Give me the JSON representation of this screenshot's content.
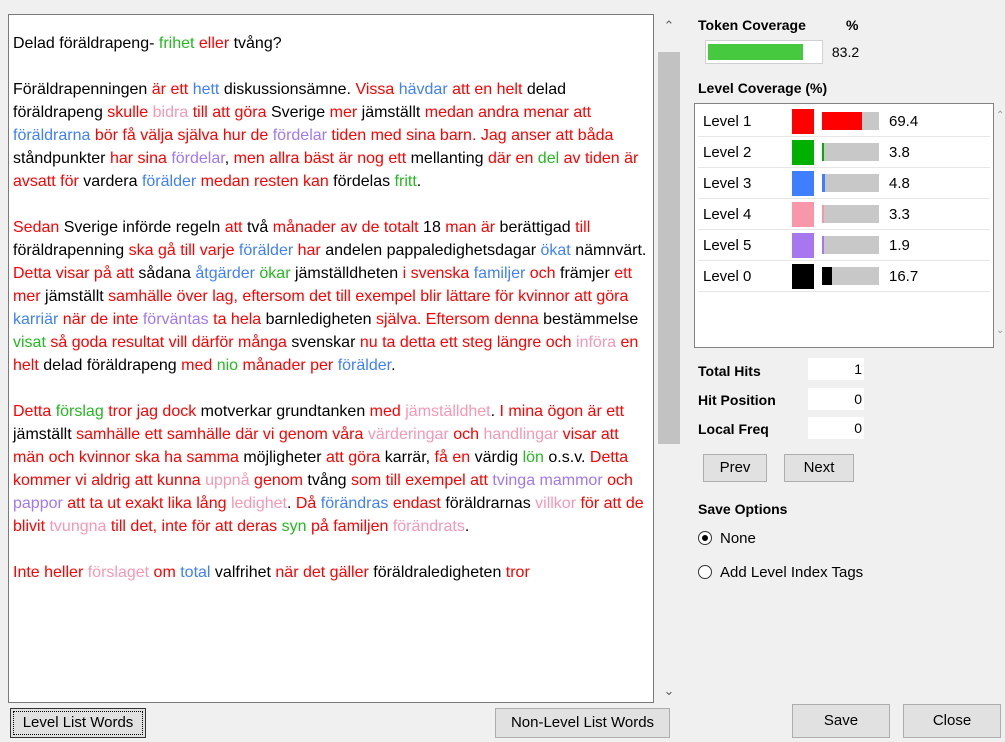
{
  "text": {
    "title": [
      [
        "lv0",
        "Delad föräldrapeng- "
      ],
      [
        "lv2",
        "frihet"
      ],
      [
        "lv0",
        " "
      ],
      [
        "lv1",
        "eller"
      ],
      [
        "lv0",
        " tvång?"
      ]
    ],
    "paragraphs": [
      [
        [
          "lv0",
          "Föräldrapenningen "
        ],
        [
          "lv1",
          "är ett"
        ],
        [
          "lv0",
          " "
        ],
        [
          "lv3",
          "hett"
        ],
        [
          "lv0",
          " diskussionsämne. "
        ],
        [
          "lv1",
          "Vissa"
        ],
        [
          "lv0",
          " "
        ],
        [
          "lv3",
          "hävdar"
        ],
        [
          "lv0",
          " "
        ],
        [
          "lv1",
          "att en helt"
        ],
        [
          "lv0",
          " delad föräldrapeng "
        ],
        [
          "lv1",
          "skulle"
        ],
        [
          "lv0",
          " "
        ],
        [
          "lv4",
          "bidra"
        ],
        [
          "lv0",
          " "
        ],
        [
          "lv1",
          "till att göra"
        ],
        [
          "lv0",
          " Sverige "
        ],
        [
          "lv1",
          "mer"
        ],
        [
          "lv0",
          " jämställt "
        ],
        [
          "lv1",
          "medan andra menar att"
        ],
        [
          "lv0",
          " "
        ],
        [
          "lv3",
          "föräldrarna"
        ],
        [
          "lv0",
          " "
        ],
        [
          "lv1",
          "bör få välja själva hur de"
        ],
        [
          "lv0",
          " "
        ],
        [
          "lv5",
          "fördelar"
        ],
        [
          "lv0",
          " "
        ],
        [
          "lv1",
          "tiden med sina barn. Jag anser att båda"
        ],
        [
          "lv0",
          " ståndpunkter "
        ],
        [
          "lv1",
          "har sina"
        ],
        [
          "lv0",
          " "
        ],
        [
          "lv5",
          "fördelar"
        ],
        [
          "lv0",
          ", "
        ],
        [
          "lv1",
          "men allra bäst är nog ett"
        ],
        [
          "lv0",
          " mellanting "
        ],
        [
          "lv1",
          "där en"
        ],
        [
          "lv0",
          " "
        ],
        [
          "lv2",
          "del"
        ],
        [
          "lv0",
          " "
        ],
        [
          "lv1",
          "av tiden är avsatt för"
        ],
        [
          "lv0",
          " vardera "
        ],
        [
          "lv3",
          "förälder"
        ],
        [
          "lv0",
          " "
        ],
        [
          "lv1",
          "medan resten kan"
        ],
        [
          "lv0",
          " fördelas "
        ],
        [
          "lv2",
          "fritt"
        ],
        [
          "lv0",
          "."
        ]
      ],
      [
        [
          "lv1",
          "Sedan"
        ],
        [
          "lv0",
          " Sverige införde regeln "
        ],
        [
          "lv1",
          "att"
        ],
        [
          "lv0",
          " två "
        ],
        [
          "lv1",
          "månader av de totalt"
        ],
        [
          "lv0",
          " 18 "
        ],
        [
          "lv1",
          "man är"
        ],
        [
          "lv0",
          " berättigad "
        ],
        [
          "lv1",
          "till"
        ],
        [
          "lv0",
          " föräldrapenning "
        ],
        [
          "lv1",
          "ska gå till varje"
        ],
        [
          "lv0",
          " "
        ],
        [
          "lv3",
          "förälder"
        ],
        [
          "lv0",
          " "
        ],
        [
          "lv1",
          "har"
        ],
        [
          "lv0",
          " andelen pappaledighetsdagar "
        ],
        [
          "lv3",
          "ökat"
        ],
        [
          "lv0",
          " nämnvärt. "
        ],
        [
          "lv1",
          "Detta visar på att"
        ],
        [
          "lv0",
          " sådana "
        ],
        [
          "lv3",
          "åtgärder"
        ],
        [
          "lv0",
          " "
        ],
        [
          "lv2",
          "ökar"
        ],
        [
          "lv0",
          " jämställdheten "
        ],
        [
          "lv1",
          "i svenska"
        ],
        [
          "lv0",
          " "
        ],
        [
          "lv3",
          "familjer"
        ],
        [
          "lv0",
          " "
        ],
        [
          "lv1",
          "och"
        ],
        [
          "lv0",
          " främjer "
        ],
        [
          "lv1",
          "ett mer"
        ],
        [
          "lv0",
          " jämställt "
        ],
        [
          "lv1",
          "samhälle över lag, eftersom det till exempel blir lättare för kvinnor att göra"
        ],
        [
          "lv0",
          " "
        ],
        [
          "lv3",
          "karriär"
        ],
        [
          "lv0",
          " "
        ],
        [
          "lv1",
          "när de inte"
        ],
        [
          "lv0",
          " "
        ],
        [
          "lv5",
          "förväntas"
        ],
        [
          "lv0",
          " "
        ],
        [
          "lv1",
          "ta hela"
        ],
        [
          "lv0",
          " barnledigheten "
        ],
        [
          "lv1",
          "själva. Eftersom denna"
        ],
        [
          "lv0",
          " bestämmelse "
        ],
        [
          "lv2",
          "visat"
        ],
        [
          "lv0",
          " "
        ],
        [
          "lv1",
          "så goda resultat vill därför många"
        ],
        [
          "lv0",
          " svenskar "
        ],
        [
          "lv1",
          "nu ta detta ett steg längre och"
        ],
        [
          "lv0",
          " "
        ],
        [
          "lv4",
          "införa"
        ],
        [
          "lv0",
          " "
        ],
        [
          "lv1",
          "en helt"
        ],
        [
          "lv0",
          " delad föräldrapeng "
        ],
        [
          "lv1",
          "med"
        ],
        [
          "lv0",
          " "
        ],
        [
          "lv2",
          "nio"
        ],
        [
          "lv0",
          " "
        ],
        [
          "lv1",
          "månader per"
        ],
        [
          "lv0",
          " "
        ],
        [
          "lv3",
          "förälder"
        ],
        [
          "lv0",
          "."
        ]
      ],
      [
        [
          "lv1",
          "Detta"
        ],
        [
          "lv0",
          " "
        ],
        [
          "lv2",
          "förslag"
        ],
        [
          "lv0",
          " "
        ],
        [
          "lv1",
          "tror jag dock"
        ],
        [
          "lv0",
          " motverkar grundtanken "
        ],
        [
          "lv1",
          "med"
        ],
        [
          "lv0",
          " "
        ],
        [
          "lv4",
          "jämställdhet"
        ],
        [
          "lv0",
          ". "
        ],
        [
          "lv1",
          "I mina ögon är ett"
        ],
        [
          "lv0",
          " jämställt "
        ],
        [
          "lv1",
          "samhälle ett samhälle där vi genom våra"
        ],
        [
          "lv0",
          " "
        ],
        [
          "lv4",
          "värderingar"
        ],
        [
          "lv0",
          " "
        ],
        [
          "lv1",
          "och"
        ],
        [
          "lv0",
          " "
        ],
        [
          "lv4",
          "handlingar"
        ],
        [
          "lv0",
          " "
        ],
        [
          "lv1",
          "visar att män och kvinnor ska ha samma"
        ],
        [
          "lv0",
          " möjligheter "
        ],
        [
          "lv1",
          "att göra"
        ],
        [
          "lv0",
          " karrär, "
        ],
        [
          "lv1",
          "få en"
        ],
        [
          "lv0",
          " värdig "
        ],
        [
          "lv2",
          "lön"
        ],
        [
          "lv0",
          " o.s.v. "
        ],
        [
          "lv1",
          "Detta kommer vi aldrig att kunna"
        ],
        [
          "lv0",
          " "
        ],
        [
          "lv4",
          "uppnå"
        ],
        [
          "lv0",
          " "
        ],
        [
          "lv1",
          "genom"
        ],
        [
          "lv0",
          " tvång "
        ],
        [
          "lv1",
          "som till exempel att"
        ],
        [
          "lv0",
          " "
        ],
        [
          "lv5",
          "tvinga mammor"
        ],
        [
          "lv0",
          " "
        ],
        [
          "lv1",
          "och"
        ],
        [
          "lv0",
          " "
        ],
        [
          "lv5",
          "pappor"
        ],
        [
          "lv0",
          " "
        ],
        [
          "lv1",
          "att ta ut exakt lika lång"
        ],
        [
          "lv0",
          " "
        ],
        [
          "lv4",
          "ledighet"
        ],
        [
          "lv0",
          ". "
        ],
        [
          "lv1",
          "Då"
        ],
        [
          "lv0",
          " "
        ],
        [
          "lv3",
          "förändras"
        ],
        [
          "lv0",
          " "
        ],
        [
          "lv1",
          "endast"
        ],
        [
          "lv0",
          " föräldrarnas "
        ],
        [
          "lv4",
          "villkor"
        ],
        [
          "lv0",
          " "
        ],
        [
          "lv1",
          "för att de blivit"
        ],
        [
          "lv0",
          " "
        ],
        [
          "lv4",
          "tvungna"
        ],
        [
          "lv0",
          " "
        ],
        [
          "lv1",
          "till det, inte för att deras"
        ],
        [
          "lv0",
          " "
        ],
        [
          "lv2",
          "syn"
        ],
        [
          "lv0",
          " "
        ],
        [
          "lv1",
          "på familjen"
        ],
        [
          "lv0",
          " "
        ],
        [
          "lv4",
          "förändrats"
        ],
        [
          "lv0",
          "."
        ]
      ],
      [
        [
          "lv1",
          "Inte heller"
        ],
        [
          "lv0",
          " "
        ],
        [
          "lv4",
          "förslaget"
        ],
        [
          "lv0",
          " "
        ],
        [
          "lv1",
          "om"
        ],
        [
          "lv0",
          " "
        ],
        [
          "lv3",
          "total"
        ],
        [
          "lv0",
          " valfrihet "
        ],
        [
          "lv1",
          "när det gäller"
        ],
        [
          "lv0",
          " föräldraledigheten "
        ],
        [
          "lv1",
          "tror"
        ]
      ]
    ]
  },
  "token_coverage": {
    "label": "Token Coverage",
    "unit": "%",
    "value": "83.2",
    "fraction": 0.832,
    "color": "#46c93f"
  },
  "level_coverage": {
    "label": "Level Coverage (%)",
    "levels": [
      {
        "name": "Level 1",
        "color": "#ff0000",
        "value": "69.4",
        "fraction": 0.694
      },
      {
        "name": "Level 2",
        "color": "#00b000",
        "value": "3.8",
        "fraction": 0.038
      },
      {
        "name": "Level 3",
        "color": "#3f7fff",
        "value": "4.8",
        "fraction": 0.048
      },
      {
        "name": "Level 4",
        "color": "#f897a9",
        "value": "3.3",
        "fraction": 0.033
      },
      {
        "name": "Level 5",
        "color": "#a777f0",
        "value": "1.9",
        "fraction": 0.019
      },
      {
        "name": "Level 0",
        "color": "#000000",
        "value": "16.7",
        "fraction": 0.167
      }
    ]
  },
  "stats": {
    "total_hits_label": "Total Hits",
    "total_hits": "1",
    "hit_position_label": "Hit Position",
    "hit_position": "0",
    "local_freq_label": "Local Freq",
    "local_freq": "0"
  },
  "nav": {
    "prev": "Prev",
    "next": "Next"
  },
  "save_options": {
    "label": "Save Options",
    "none": "None",
    "add_tags": "Add Level Index Tags",
    "selected": "none"
  },
  "buttons": {
    "level_list": "Level List Words",
    "non_level_list": "Non-Level List Words",
    "save": "Save",
    "close": "Close"
  },
  "icons": {
    "scroll_up": "chevron-up-icon",
    "scroll_down": "chevron-down-icon"
  }
}
